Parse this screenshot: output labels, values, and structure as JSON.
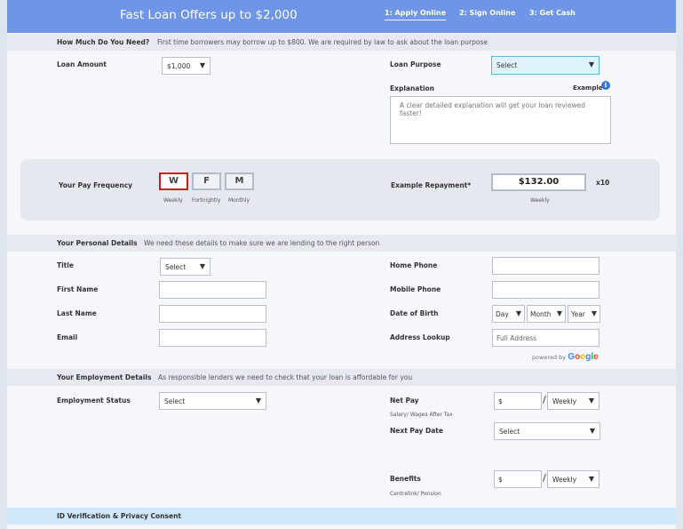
{
  "header": {
    "title": "Fast Loan Offers up to $2,000",
    "steps": [
      "1: Apply Online",
      "2: Sign Online",
      "3: Get Cash"
    ]
  },
  "section1": {
    "heading": "How Much Do You Need?",
    "subtext": "First time borrowers may borrow up to $800. We are required by law to ask about the loan purpose",
    "loan_amount_label": "Loan Amount",
    "loan_amount_value": "$1,000",
    "loan_purpose_label": "Loan Purpose",
    "loan_purpose_value": "Select",
    "explanation_label": "Explanation",
    "example_label": "Example",
    "explanation_placeholder": "A clear detailed explanation will get your loan reviewed faster!"
  },
  "pay": {
    "frequency_label": "Your Pay Frequency",
    "options": [
      {
        "letter": "W",
        "caption": "Weekly"
      },
      {
        "letter": "F",
        "caption": "Fortnightly"
      },
      {
        "letter": "M",
        "caption": "Monthly"
      }
    ],
    "selected": "W",
    "repayment_label": "Example Repayment*",
    "repayment_value": "$132.00",
    "repayment_caption": "Weekly",
    "repayment_multiplier": "x10"
  },
  "personal": {
    "heading": "Your Personal Details",
    "subtext": "We need these details to make sure we are lending to the right person",
    "title_label": "Title",
    "title_value": "Select",
    "first_name_label": "First Name",
    "last_name_label": "Last Name",
    "email_label": "Email",
    "home_phone_label": "Home Phone",
    "mobile_phone_label": "Mobile Phone",
    "dob_label": "Date of Birth",
    "dob_day": "Day",
    "dob_month": "Month",
    "dob_year": "Year",
    "address_label": "Address Lookup",
    "address_placeholder": "Full Address",
    "powered_by": "powered by",
    "google": "Google"
  },
  "employment": {
    "heading": "Your Employment Details",
    "subtext": "As responsible lenders we need to check that your loan is affordable for you",
    "status_label": "Employment Status",
    "status_value": "Select",
    "net_pay_label": "Net Pay",
    "net_pay_caption": "Salary/ Wages After Tax",
    "net_pay_currency": "$",
    "net_pay_freq": "Weekly",
    "next_pay_label": "Next Pay Date",
    "next_pay_value": "Select",
    "benefits_label": "Benefits",
    "benefits_caption": "Centrelink/ Pension",
    "benefits_currency": "$",
    "benefits_freq": "Weekly"
  },
  "id_section": {
    "heading": "ID Verification & Privacy Consent"
  },
  "colors": {
    "header": "#6e95e6",
    "selected_border": "#d9151a",
    "id_bar": "#cfe8fa"
  }
}
